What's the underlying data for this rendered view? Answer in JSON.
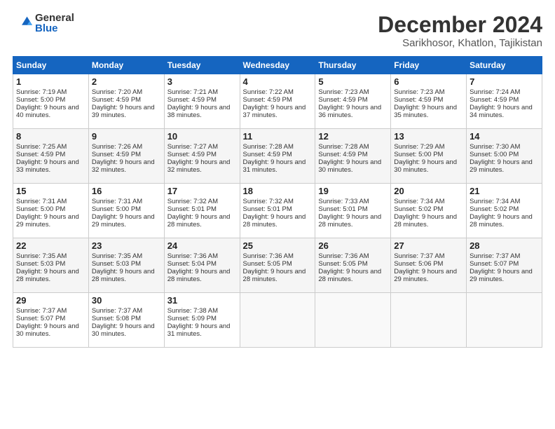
{
  "header": {
    "logo_general": "General",
    "logo_blue": "Blue",
    "month_title": "December 2024",
    "location": "Sarikhosor, Khatlon, Tajikistan"
  },
  "days_of_week": [
    "Sunday",
    "Monday",
    "Tuesday",
    "Wednesday",
    "Thursday",
    "Friday",
    "Saturday"
  ],
  "weeks": [
    [
      {
        "day": 1,
        "sunrise": "7:19 AM",
        "sunset": "5:00 PM",
        "daylight": "9 hours and 40 minutes."
      },
      {
        "day": 2,
        "sunrise": "7:20 AM",
        "sunset": "4:59 PM",
        "daylight": "9 hours and 39 minutes."
      },
      {
        "day": 3,
        "sunrise": "7:21 AM",
        "sunset": "4:59 PM",
        "daylight": "9 hours and 38 minutes."
      },
      {
        "day": 4,
        "sunrise": "7:22 AM",
        "sunset": "4:59 PM",
        "daylight": "9 hours and 37 minutes."
      },
      {
        "day": 5,
        "sunrise": "7:23 AM",
        "sunset": "4:59 PM",
        "daylight": "9 hours and 36 minutes."
      },
      {
        "day": 6,
        "sunrise": "7:23 AM",
        "sunset": "4:59 PM",
        "daylight": "9 hours and 35 minutes."
      },
      {
        "day": 7,
        "sunrise": "7:24 AM",
        "sunset": "4:59 PM",
        "daylight": "9 hours and 34 minutes."
      }
    ],
    [
      {
        "day": 8,
        "sunrise": "7:25 AM",
        "sunset": "4:59 PM",
        "daylight": "9 hours and 33 minutes."
      },
      {
        "day": 9,
        "sunrise": "7:26 AM",
        "sunset": "4:59 PM",
        "daylight": "9 hours and 32 minutes."
      },
      {
        "day": 10,
        "sunrise": "7:27 AM",
        "sunset": "4:59 PM",
        "daylight": "9 hours and 32 minutes."
      },
      {
        "day": 11,
        "sunrise": "7:28 AM",
        "sunset": "4:59 PM",
        "daylight": "9 hours and 31 minutes."
      },
      {
        "day": 12,
        "sunrise": "7:28 AM",
        "sunset": "4:59 PM",
        "daylight": "9 hours and 30 minutes."
      },
      {
        "day": 13,
        "sunrise": "7:29 AM",
        "sunset": "5:00 PM",
        "daylight": "9 hours and 30 minutes."
      },
      {
        "day": 14,
        "sunrise": "7:30 AM",
        "sunset": "5:00 PM",
        "daylight": "9 hours and 29 minutes."
      }
    ],
    [
      {
        "day": 15,
        "sunrise": "7:31 AM",
        "sunset": "5:00 PM",
        "daylight": "9 hours and 29 minutes."
      },
      {
        "day": 16,
        "sunrise": "7:31 AM",
        "sunset": "5:00 PM",
        "daylight": "9 hours and 29 minutes."
      },
      {
        "day": 17,
        "sunrise": "7:32 AM",
        "sunset": "5:01 PM",
        "daylight": "9 hours and 28 minutes."
      },
      {
        "day": 18,
        "sunrise": "7:32 AM",
        "sunset": "5:01 PM",
        "daylight": "9 hours and 28 minutes."
      },
      {
        "day": 19,
        "sunrise": "7:33 AM",
        "sunset": "5:01 PM",
        "daylight": "9 hours and 28 minutes."
      },
      {
        "day": 20,
        "sunrise": "7:34 AM",
        "sunset": "5:02 PM",
        "daylight": "9 hours and 28 minutes."
      },
      {
        "day": 21,
        "sunrise": "7:34 AM",
        "sunset": "5:02 PM",
        "daylight": "9 hours and 28 minutes."
      }
    ],
    [
      {
        "day": 22,
        "sunrise": "7:35 AM",
        "sunset": "5:03 PM",
        "daylight": "9 hours and 28 minutes."
      },
      {
        "day": 23,
        "sunrise": "7:35 AM",
        "sunset": "5:03 PM",
        "daylight": "9 hours and 28 minutes."
      },
      {
        "day": 24,
        "sunrise": "7:36 AM",
        "sunset": "5:04 PM",
        "daylight": "9 hours and 28 minutes."
      },
      {
        "day": 25,
        "sunrise": "7:36 AM",
        "sunset": "5:05 PM",
        "daylight": "9 hours and 28 minutes."
      },
      {
        "day": 26,
        "sunrise": "7:36 AM",
        "sunset": "5:05 PM",
        "daylight": "9 hours and 28 minutes."
      },
      {
        "day": 27,
        "sunrise": "7:37 AM",
        "sunset": "5:06 PM",
        "daylight": "9 hours and 29 minutes."
      },
      {
        "day": 28,
        "sunrise": "7:37 AM",
        "sunset": "5:07 PM",
        "daylight": "9 hours and 29 minutes."
      }
    ],
    [
      {
        "day": 29,
        "sunrise": "7:37 AM",
        "sunset": "5:07 PM",
        "daylight": "9 hours and 30 minutes."
      },
      {
        "day": 30,
        "sunrise": "7:37 AM",
        "sunset": "5:08 PM",
        "daylight": "9 hours and 30 minutes."
      },
      {
        "day": 31,
        "sunrise": "7:38 AM",
        "sunset": "5:09 PM",
        "daylight": "9 hours and 31 minutes."
      },
      null,
      null,
      null,
      null
    ]
  ]
}
